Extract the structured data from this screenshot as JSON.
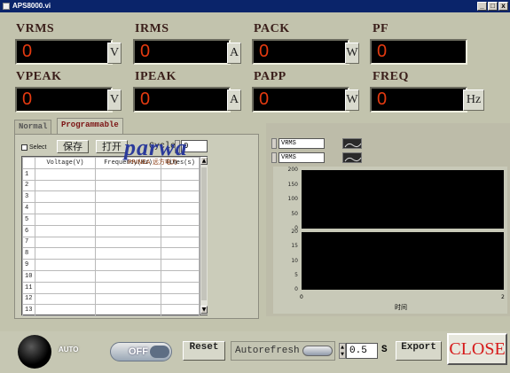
{
  "window": {
    "title": "APS8000.vi",
    "min": "_",
    "max": "□",
    "close": "x"
  },
  "meters": [
    {
      "label": "VRMS",
      "value": "0",
      "unit": "V"
    },
    {
      "label": "IRMS",
      "value": "0",
      "unit": "A"
    },
    {
      "label": "PACK",
      "value": "0",
      "unit": "W"
    },
    {
      "label": "PF",
      "value": "0",
      "unit": ""
    },
    {
      "label": "VPEAK",
      "value": "0",
      "unit": "V"
    },
    {
      "label": "IPEAK",
      "value": "0",
      "unit": "A"
    },
    {
      "label": "PAPP",
      "value": "0",
      "unit": "W"
    },
    {
      "label": "FREQ",
      "value": "0",
      "unit": "Hz"
    }
  ],
  "tabs": {
    "normal": "Normal",
    "programmable": "Programmable"
  },
  "program": {
    "select_label": "Select",
    "save_label": "保存",
    "open_label": "打开",
    "cycle_label": "Cycle",
    "cycle_value": "0",
    "columns": [
      "Voltage(V)",
      "Frequency(Hz)",
      "Times(s)"
    ],
    "row_numbers": [
      "1",
      "2",
      "3",
      "4",
      "5",
      "6",
      "7",
      "8",
      "9",
      "10",
      "11",
      "12",
      "13"
    ]
  },
  "chart": {
    "channel_1": "VRMS",
    "channel_2": "VRMS",
    "logo": "parwa",
    "logo_sub": "PRINEA 远方电力",
    "xlabel": "时间"
  },
  "chart_data": [
    {
      "type": "line",
      "title": "",
      "xlabel": "",
      "ylabel": "",
      "series": [],
      "xlim": [
        0,
        2
      ],
      "ylim": [
        0,
        200
      ],
      "yticks": [
        "200",
        "150",
        "100",
        "50",
        "0"
      ]
    },
    {
      "type": "line",
      "title": "",
      "xlabel": "时间",
      "ylabel": "",
      "series": [],
      "xlim": [
        0,
        2
      ],
      "ylim": [
        0,
        20
      ],
      "yticks": [
        "20",
        "15",
        "10",
        "5",
        "0"
      ],
      "xticks": [
        "0",
        "2"
      ]
    }
  ],
  "bottom": {
    "auto_label": "AUTO",
    "onoff_label": "OFF",
    "reset_label": "Reset",
    "autorefresh_label": "Autorefresh",
    "interval_value": "0.5",
    "interval_unit": "S",
    "export_label": "Export",
    "close_label": "CLOSE"
  },
  "colors": {
    "display_text": "#e43a10",
    "close_text": "#d61a1a",
    "title_bar": "#0a246a"
  }
}
